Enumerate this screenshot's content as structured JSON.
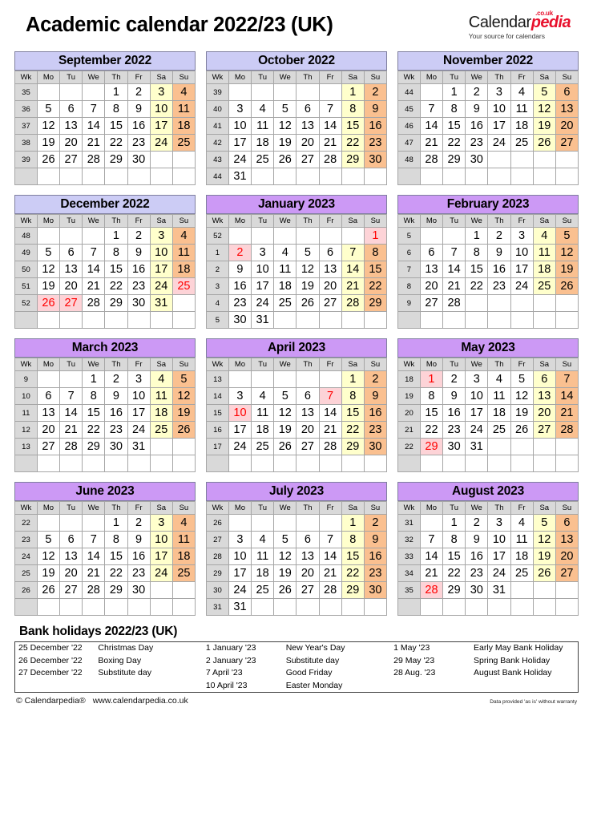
{
  "header": {
    "title": "Academic calendar 2022/23 (UK)",
    "logo": {
      "brand_black": "Calendar",
      "brand_red": "pedia",
      "tld": ".co.uk",
      "tagline": "Your source for calendars",
      "red_hex": "#e8112d"
    }
  },
  "theme": {
    "header_2022_hex": "#ccccf5",
    "header_2023_hex": "#cc99f5",
    "saturday_hex": "#ffffcc",
    "sunday_hex": "#fac090",
    "weeknum_hex": "#d9d9d9",
    "holiday_bg_hex": "#fdd3d7",
    "holiday_text_hex": "#ff0000"
  },
  "weekday_headers": [
    "Wk",
    "Mo",
    "Tu",
    "We",
    "Th",
    "Fr",
    "Sa",
    "Su"
  ],
  "months": [
    {
      "name": "September 2022",
      "year_group": "y2022",
      "weeks": [
        {
          "wk": "35",
          "days": [
            "",
            "",
            "",
            "1",
            "2",
            "3",
            "4"
          ]
        },
        {
          "wk": "36",
          "days": [
            "5",
            "6",
            "7",
            "8",
            "9",
            "10",
            "11"
          ]
        },
        {
          "wk": "37",
          "days": [
            "12",
            "13",
            "14",
            "15",
            "16",
            "17",
            "18"
          ]
        },
        {
          "wk": "38",
          "days": [
            "19",
            "20",
            "21",
            "22",
            "23",
            "24",
            "25"
          ]
        },
        {
          "wk": "39",
          "days": [
            "26",
            "27",
            "28",
            "29",
            "30",
            "",
            ""
          ]
        },
        {
          "wk": "",
          "days": [
            "",
            "",
            "",
            "",
            "",
            "",
            ""
          ]
        }
      ],
      "holidays": []
    },
    {
      "name": "October 2022",
      "year_group": "y2022",
      "weeks": [
        {
          "wk": "39",
          "days": [
            "",
            "",
            "",
            "",
            "",
            "1",
            "2"
          ]
        },
        {
          "wk": "40",
          "days": [
            "3",
            "4",
            "5",
            "6",
            "7",
            "8",
            "9"
          ]
        },
        {
          "wk": "41",
          "days": [
            "10",
            "11",
            "12",
            "13",
            "14",
            "15",
            "16"
          ]
        },
        {
          "wk": "42",
          "days": [
            "17",
            "18",
            "19",
            "20",
            "21",
            "22",
            "23"
          ]
        },
        {
          "wk": "43",
          "days": [
            "24",
            "25",
            "26",
            "27",
            "28",
            "29",
            "30"
          ]
        },
        {
          "wk": "44",
          "days": [
            "31",
            "",
            "",
            "",
            "",
            "",
            ""
          ]
        }
      ],
      "holidays": []
    },
    {
      "name": "November 2022",
      "year_group": "y2022",
      "weeks": [
        {
          "wk": "44",
          "days": [
            "",
            "1",
            "2",
            "3",
            "4",
            "5",
            "6"
          ]
        },
        {
          "wk": "45",
          "days": [
            "7",
            "8",
            "9",
            "10",
            "11",
            "12",
            "13"
          ]
        },
        {
          "wk": "46",
          "days": [
            "14",
            "15",
            "16",
            "17",
            "18",
            "19",
            "20"
          ]
        },
        {
          "wk": "47",
          "days": [
            "21",
            "22",
            "23",
            "24",
            "25",
            "26",
            "27"
          ]
        },
        {
          "wk": "48",
          "days": [
            "28",
            "29",
            "30",
            "",
            "",
            "",
            ""
          ]
        },
        {
          "wk": "",
          "days": [
            "",
            "",
            "",
            "",
            "",
            "",
            ""
          ]
        }
      ],
      "holidays": []
    },
    {
      "name": "December 2022",
      "year_group": "y2022",
      "weeks": [
        {
          "wk": "48",
          "days": [
            "",
            "",
            "",
            "1",
            "2",
            "3",
            "4"
          ]
        },
        {
          "wk": "49",
          "days": [
            "5",
            "6",
            "7",
            "8",
            "9",
            "10",
            "11"
          ]
        },
        {
          "wk": "50",
          "days": [
            "12",
            "13",
            "14",
            "15",
            "16",
            "17",
            "18"
          ]
        },
        {
          "wk": "51",
          "days": [
            "19",
            "20",
            "21",
            "22",
            "23",
            "24",
            "25"
          ]
        },
        {
          "wk": "52",
          "days": [
            "26",
            "27",
            "28",
            "29",
            "30",
            "31",
            ""
          ]
        },
        {
          "wk": "",
          "days": [
            "",
            "",
            "",
            "",
            "",
            "",
            ""
          ]
        }
      ],
      "holidays": [
        "25",
        "26",
        "27"
      ]
    },
    {
      "name": "January 2023",
      "year_group": "y2023",
      "weeks": [
        {
          "wk": "52",
          "days": [
            "",
            "",
            "",
            "",
            "",
            "",
            "1"
          ]
        },
        {
          "wk": "1",
          "days": [
            "2",
            "3",
            "4",
            "5",
            "6",
            "7",
            "8"
          ]
        },
        {
          "wk": "2",
          "days": [
            "9",
            "10",
            "11",
            "12",
            "13",
            "14",
            "15"
          ]
        },
        {
          "wk": "3",
          "days": [
            "16",
            "17",
            "18",
            "19",
            "20",
            "21",
            "22"
          ]
        },
        {
          "wk": "4",
          "days": [
            "23",
            "24",
            "25",
            "26",
            "27",
            "28",
            "29"
          ]
        },
        {
          "wk": "5",
          "days": [
            "30",
            "31",
            "",
            "",
            "",
            "",
            ""
          ]
        }
      ],
      "holidays": [
        "1",
        "2"
      ]
    },
    {
      "name": "February 2023",
      "year_group": "y2023",
      "weeks": [
        {
          "wk": "5",
          "days": [
            "",
            "",
            "1",
            "2",
            "3",
            "4",
            "5"
          ]
        },
        {
          "wk": "6",
          "days": [
            "6",
            "7",
            "8",
            "9",
            "10",
            "11",
            "12"
          ]
        },
        {
          "wk": "7",
          "days": [
            "13",
            "14",
            "15",
            "16",
            "17",
            "18",
            "19"
          ]
        },
        {
          "wk": "8",
          "days": [
            "20",
            "21",
            "22",
            "23",
            "24",
            "25",
            "26"
          ]
        },
        {
          "wk": "9",
          "days": [
            "27",
            "28",
            "",
            "",
            "",
            "",
            ""
          ]
        },
        {
          "wk": "",
          "days": [
            "",
            "",
            "",
            "",
            "",
            "",
            ""
          ]
        }
      ],
      "holidays": []
    },
    {
      "name": "March 2023",
      "year_group": "y2023",
      "weeks": [
        {
          "wk": "9",
          "days": [
            "",
            "",
            "1",
            "2",
            "3",
            "4",
            "5"
          ]
        },
        {
          "wk": "10",
          "days": [
            "6",
            "7",
            "8",
            "9",
            "10",
            "11",
            "12"
          ]
        },
        {
          "wk": "11",
          "days": [
            "13",
            "14",
            "15",
            "16",
            "17",
            "18",
            "19"
          ]
        },
        {
          "wk": "12",
          "days": [
            "20",
            "21",
            "22",
            "23",
            "24",
            "25",
            "26"
          ]
        },
        {
          "wk": "13",
          "days": [
            "27",
            "28",
            "29",
            "30",
            "31",
            "",
            ""
          ]
        },
        {
          "wk": "",
          "days": [
            "",
            "",
            "",
            "",
            "",
            "",
            ""
          ]
        }
      ],
      "holidays": []
    },
    {
      "name": "April 2023",
      "year_group": "y2023",
      "weeks": [
        {
          "wk": "13",
          "days": [
            "",
            "",
            "",
            "",
            "",
            "1",
            "2"
          ]
        },
        {
          "wk": "14",
          "days": [
            "3",
            "4",
            "5",
            "6",
            "7",
            "8",
            "9"
          ]
        },
        {
          "wk": "15",
          "days": [
            "10",
            "11",
            "12",
            "13",
            "14",
            "15",
            "16"
          ]
        },
        {
          "wk": "16",
          "days": [
            "17",
            "18",
            "19",
            "20",
            "21",
            "22",
            "23"
          ]
        },
        {
          "wk": "17",
          "days": [
            "24",
            "25",
            "26",
            "27",
            "28",
            "29",
            "30"
          ]
        },
        {
          "wk": "",
          "days": [
            "",
            "",
            "",
            "",
            "",
            "",
            ""
          ]
        }
      ],
      "holidays": [
        "7",
        "10"
      ]
    },
    {
      "name": "May 2023",
      "year_group": "y2023",
      "weeks": [
        {
          "wk": "18",
          "days": [
            "1",
            "2",
            "3",
            "4",
            "5",
            "6",
            "7"
          ]
        },
        {
          "wk": "19",
          "days": [
            "8",
            "9",
            "10",
            "11",
            "12",
            "13",
            "14"
          ]
        },
        {
          "wk": "20",
          "days": [
            "15",
            "16",
            "17",
            "18",
            "19",
            "20",
            "21"
          ]
        },
        {
          "wk": "21",
          "days": [
            "22",
            "23",
            "24",
            "25",
            "26",
            "27",
            "28"
          ]
        },
        {
          "wk": "22",
          "days": [
            "29",
            "30",
            "31",
            "",
            "",
            "",
            ""
          ]
        },
        {
          "wk": "",
          "days": [
            "",
            "",
            "",
            "",
            "",
            "",
            ""
          ]
        }
      ],
      "holidays": [
        "1",
        "29"
      ]
    },
    {
      "name": "June 2023",
      "year_group": "y2023",
      "weeks": [
        {
          "wk": "22",
          "days": [
            "",
            "",
            "",
            "1",
            "2",
            "3",
            "4"
          ]
        },
        {
          "wk": "23",
          "days": [
            "5",
            "6",
            "7",
            "8",
            "9",
            "10",
            "11"
          ]
        },
        {
          "wk": "24",
          "days": [
            "12",
            "13",
            "14",
            "15",
            "16",
            "17",
            "18"
          ]
        },
        {
          "wk": "25",
          "days": [
            "19",
            "20",
            "21",
            "22",
            "23",
            "24",
            "25"
          ]
        },
        {
          "wk": "26",
          "days": [
            "26",
            "27",
            "28",
            "29",
            "30",
            "",
            ""
          ]
        },
        {
          "wk": "",
          "days": [
            "",
            "",
            "",
            "",
            "",
            "",
            ""
          ]
        }
      ],
      "holidays": []
    },
    {
      "name": "July 2023",
      "year_group": "y2023",
      "weeks": [
        {
          "wk": "26",
          "days": [
            "",
            "",
            "",
            "",
            "",
            "1",
            "2"
          ]
        },
        {
          "wk": "27",
          "days": [
            "3",
            "4",
            "5",
            "6",
            "7",
            "8",
            "9"
          ]
        },
        {
          "wk": "28",
          "days": [
            "10",
            "11",
            "12",
            "13",
            "14",
            "15",
            "16"
          ]
        },
        {
          "wk": "29",
          "days": [
            "17",
            "18",
            "19",
            "20",
            "21",
            "22",
            "23"
          ]
        },
        {
          "wk": "30",
          "days": [
            "24",
            "25",
            "26",
            "27",
            "28",
            "29",
            "30"
          ]
        },
        {
          "wk": "31",
          "days": [
            "31",
            "",
            "",
            "",
            "",
            "",
            ""
          ]
        }
      ],
      "holidays": []
    },
    {
      "name": "August 2023",
      "year_group": "y2023",
      "weeks": [
        {
          "wk": "31",
          "days": [
            "",
            "1",
            "2",
            "3",
            "4",
            "5",
            "6"
          ]
        },
        {
          "wk": "32",
          "days": [
            "7",
            "8",
            "9",
            "10",
            "11",
            "12",
            "13"
          ]
        },
        {
          "wk": "33",
          "days": [
            "14",
            "15",
            "16",
            "17",
            "18",
            "19",
            "20"
          ]
        },
        {
          "wk": "34",
          "days": [
            "21",
            "22",
            "23",
            "24",
            "25",
            "26",
            "27"
          ]
        },
        {
          "wk": "35",
          "days": [
            "28",
            "29",
            "30",
            "31",
            "",
            "",
            ""
          ]
        },
        {
          "wk": "",
          "days": [
            "",
            "",
            "",
            "",
            "",
            "",
            ""
          ]
        }
      ],
      "holidays": [
        "28"
      ]
    }
  ],
  "bank_holidays": {
    "title": "Bank holidays 2022/23 (UK)",
    "rows": [
      [
        {
          "date": "25 December '22",
          "name": "Christmas Day"
        },
        {
          "date": "1 January '23",
          "name": "New Year's Day"
        },
        {
          "date": "1 May '23",
          "name": "Early May Bank Holiday"
        }
      ],
      [
        {
          "date": "26 December '22",
          "name": "Boxing Day"
        },
        {
          "date": "2 January '23",
          "name": "Substitute day"
        },
        {
          "date": "29 May '23",
          "name": "Spring Bank Holiday"
        }
      ],
      [
        {
          "date": "27 December '22",
          "name": "Substitute day"
        },
        {
          "date": "7 April '23",
          "name": "Good Friday"
        },
        {
          "date": "28 Aug. '23",
          "name": "August Bank Holiday"
        }
      ],
      [
        {
          "date": "",
          "name": ""
        },
        {
          "date": "10 April '23",
          "name": "Easter Monday"
        },
        {
          "date": "",
          "name": ""
        }
      ]
    ]
  },
  "footer": {
    "copyright": "© Calendarpedia®",
    "url": "www.calendarpedia.co.uk",
    "disclaimer": "Data provided 'as is' without warranty"
  }
}
